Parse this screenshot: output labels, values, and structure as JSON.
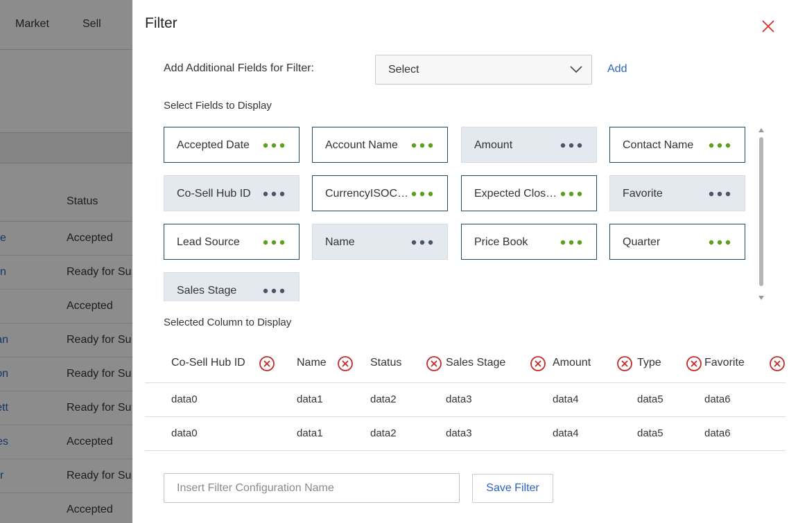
{
  "background": {
    "nav": [
      "Market",
      "Sell"
    ],
    "status_header": "Status",
    "rows": [
      {
        "name": "e",
        "status": "Accepted"
      },
      {
        "name": "n",
        "status": "Ready for Su"
      },
      {
        "name": "",
        "status": "Accepted"
      },
      {
        "name": "gan",
        "status": "Ready for Su"
      },
      {
        "name": "erson",
        "status": "Ready for Su"
      },
      {
        "name": "cett",
        "status": "Ready for Su"
      },
      {
        "name": "ques",
        "status": "Accepted"
      },
      {
        "name": "r",
        "status": "Ready for Su"
      },
      {
        "name": "",
        "status": "Accepted"
      }
    ]
  },
  "filter": {
    "title": "Filter",
    "additional_label": "Add Additional Fields for Filter:",
    "select_value": "Select",
    "add_label": "Add",
    "select_fields_label": "Select Fields to Display",
    "fields": [
      {
        "label": "Accepted Date",
        "selected": true
      },
      {
        "label": "Account Name",
        "selected": true
      },
      {
        "label": "Amount",
        "selected": false
      },
      {
        "label": "Contact Name",
        "selected": true
      },
      {
        "label": "Co-Sell Hub ID",
        "selected": false
      },
      {
        "label": "CurrencyISOCode",
        "selected": true
      },
      {
        "label": "Expected Close Date",
        "selected": true
      },
      {
        "label": "Favorite",
        "selected": false
      },
      {
        "label": "Lead Source",
        "selected": true
      },
      {
        "label": "Name",
        "selected": false
      },
      {
        "label": "Price Book",
        "selected": true
      },
      {
        "label": "Quarter",
        "selected": true
      },
      {
        "label": "Sales Stage",
        "selected": false
      }
    ],
    "selected_columns_label": "Selected Column to Display",
    "columns": [
      "Co-Sell Hub ID",
      "Name",
      "Status",
      "Sales Stage",
      "Amount",
      "Type",
      "Favorite"
    ],
    "rows": [
      [
        "data0",
        "data1",
        "data2",
        "data3",
        "data4",
        "data5",
        "data6"
      ],
      [
        "data0",
        "data1",
        "data2",
        "data3",
        "data4",
        "data5",
        "data6"
      ]
    ],
    "config_placeholder": "Insert Filter Configuration Name",
    "save_label": "Save Filter"
  },
  "colors": {
    "accent_link": "#2a62c4",
    "dots_active": "#5aa01e",
    "dots_inactive": "#4a5568",
    "remove_icon": "#c62828",
    "close_icon": "#d32f2f"
  }
}
